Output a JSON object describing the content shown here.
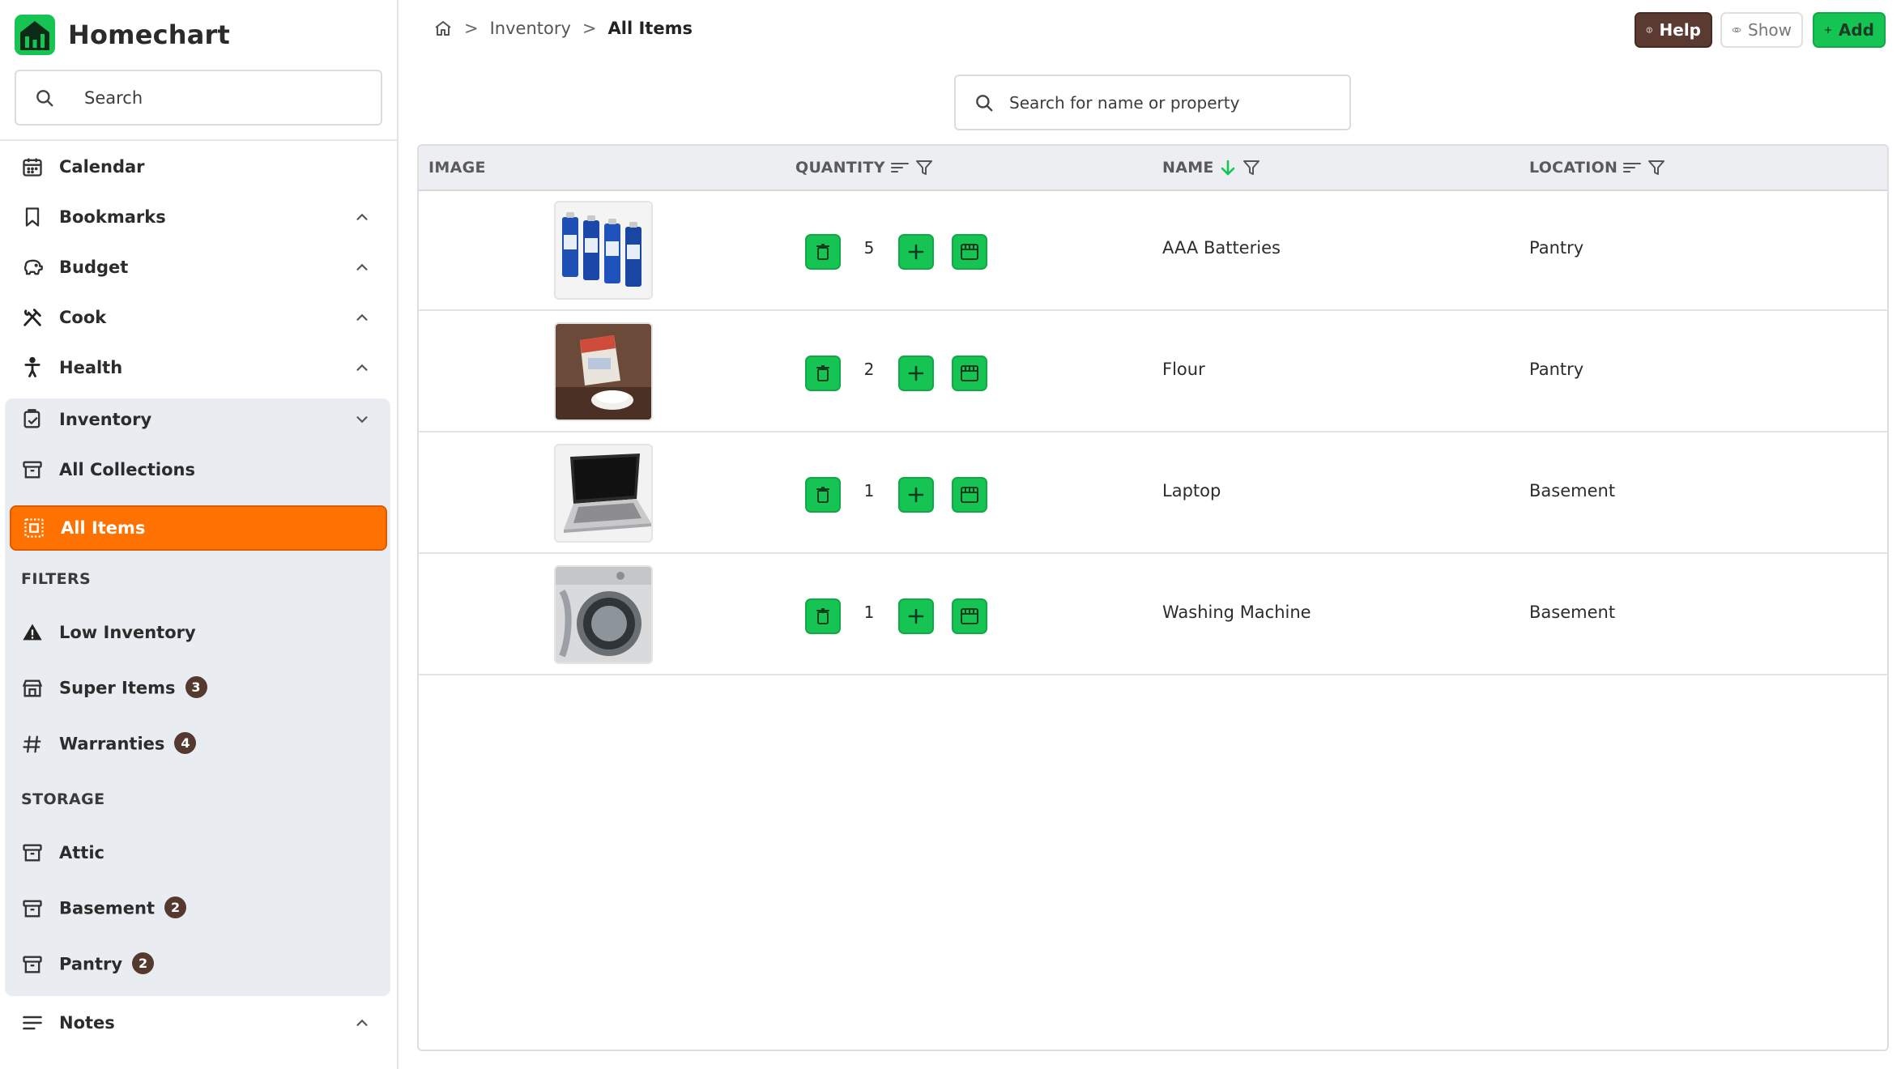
{
  "app": {
    "name": "Homechart",
    "brand_color": "#16c454",
    "accent_color": "#ff7100"
  },
  "sidebar": {
    "search_placeholder": "Search",
    "nav": [
      {
        "label": "Calendar",
        "icon": "calendar-icon"
      },
      {
        "label": "Bookmarks",
        "icon": "bookmark-icon"
      },
      {
        "label": "Budget",
        "icon": "piggy-bank-icon"
      },
      {
        "label": "Cook",
        "icon": "utensils-icon"
      },
      {
        "label": "Health",
        "icon": "accessibility-icon"
      },
      {
        "label": "Inventory",
        "icon": "inventory-icon"
      }
    ],
    "inventory_sub": {
      "all_collections": "All Collections",
      "all_items": "All Items"
    },
    "filters_label": "FILTERS",
    "filters": [
      {
        "label": "Low Inventory",
        "badge": ""
      },
      {
        "label": "Super Items",
        "badge": "3"
      },
      {
        "label": "Warranties",
        "badge": "4"
      }
    ],
    "storage_label": "STORAGE",
    "storage": [
      {
        "label": "Attic",
        "badge": ""
      },
      {
        "label": "Basement",
        "badge": "2"
      },
      {
        "label": "Pantry",
        "badge": "2"
      }
    ],
    "notes": "Notes"
  },
  "header": {
    "breadcrumb": {
      "inventory": "Inventory",
      "current": "All Items",
      "separator": ">"
    },
    "help_label": "Help",
    "show_label": "Show",
    "add_label": "Add"
  },
  "search": {
    "placeholder": "Search for name or property"
  },
  "table": {
    "columns": {
      "image": "IMAGE",
      "quantity": "QUANTITY",
      "name": "NAME",
      "location": "LOCATION"
    },
    "rows": [
      {
        "image": "batteries",
        "quantity": "5",
        "name": "AAA Batteries",
        "location": "Pantry"
      },
      {
        "image": "flour",
        "quantity": "2",
        "name": "Flour",
        "location": "Pantry"
      },
      {
        "image": "laptop",
        "quantity": "1",
        "name": "Laptop",
        "location": "Basement"
      },
      {
        "image": "washing-machine",
        "quantity": "1",
        "name": "Washing Machine",
        "location": "Basement"
      }
    ]
  }
}
